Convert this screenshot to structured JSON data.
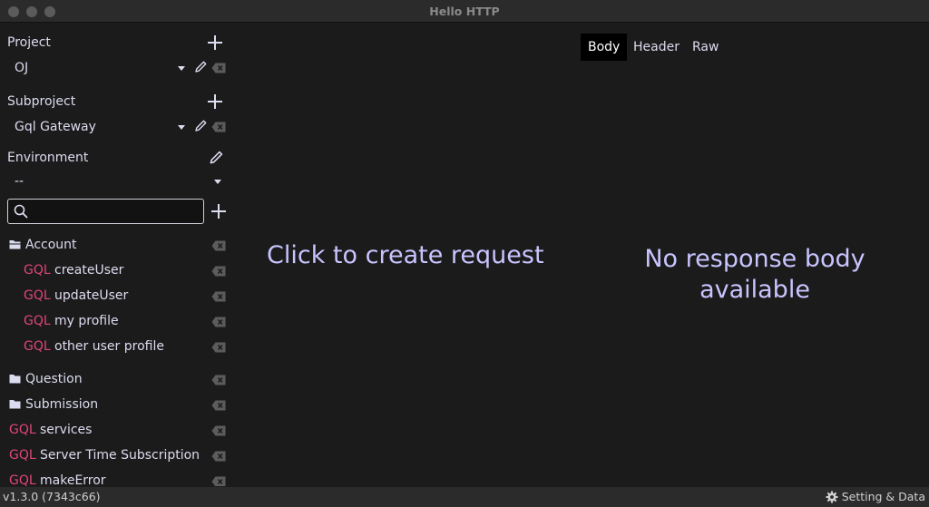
{
  "window": {
    "title": "Hello HTTP"
  },
  "project": {
    "label": "Project",
    "value": "OJ"
  },
  "subproject": {
    "label": "Subproject",
    "value": "Gql Gateway"
  },
  "environment": {
    "label": "Environment",
    "value": "--"
  },
  "search": {
    "placeholder": "",
    "value": ""
  },
  "tree": {
    "gql_tag": "GQL",
    "account": {
      "name": "Account",
      "children": [
        "createUser",
        "updateUser",
        "my profile",
        "other user profile"
      ]
    },
    "folders": [
      "Question",
      "Submission"
    ],
    "requests": [
      "services",
      "Server Time Subscription",
      "makeError"
    ]
  },
  "request": {
    "empty_text": "Click to create request"
  },
  "response": {
    "tabs": [
      "Body",
      "Header",
      "Raw"
    ],
    "active_tab": "Body",
    "empty_line1": "No response body",
    "empty_line2": "available"
  },
  "status": {
    "version": "v1.3.0 (7343c66)",
    "settings_label": "Setting & Data"
  },
  "icons": {
    "add": "plus-icon",
    "edit": "pencil-icon",
    "delete": "backspace-icon",
    "folder": "folder-icon",
    "search": "search-icon",
    "settings": "gear-icon"
  },
  "colors": {
    "gql": "#e0457b",
    "accent_text": "#c8c4ff",
    "background": "#1b1b1b"
  }
}
